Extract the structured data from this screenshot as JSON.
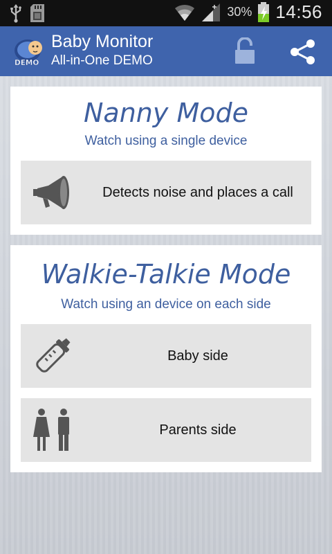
{
  "status_bar": {
    "battery_pct": "30%",
    "time": "14:56"
  },
  "action_bar": {
    "title": "Baby Monitor",
    "subtitle": "All-in-One DEMO",
    "logo_badge": "DEMO",
    "color": "#3f64ad"
  },
  "nanny": {
    "title": "Nanny Mode",
    "subtitle": "Watch using a single device",
    "option": {
      "label": "Detects noise and places a call",
      "icon": "megaphone-icon"
    }
  },
  "walkie": {
    "title": "Walkie-Talkie Mode",
    "subtitle": "Watch using an device on each side",
    "options": [
      {
        "label": "Baby side",
        "icon": "baby-bottle-icon"
      },
      {
        "label": "Parents side",
        "icon": "parents-icon"
      }
    ]
  }
}
